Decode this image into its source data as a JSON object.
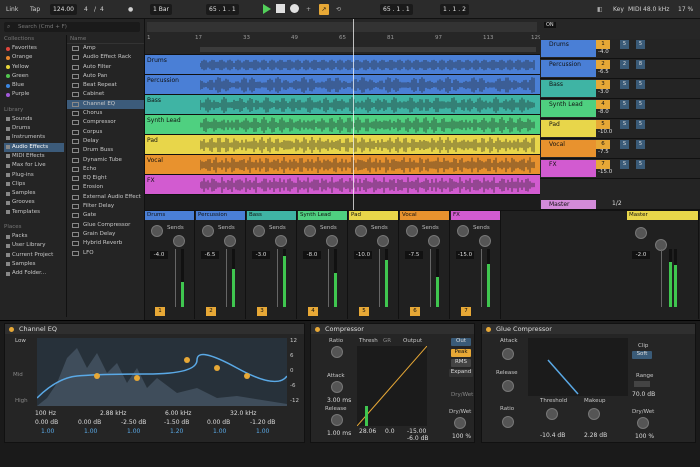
{
  "topbar": {
    "link": "Link",
    "tap": "Tap",
    "tempo": "124.00",
    "meter_num": "4",
    "meter_den": "4",
    "quant": "1 Bar",
    "position": "65 . 1 . 1",
    "position2": "65 . 1 . 1",
    "loop_end": "1 . 1 . 2",
    "key": "Key",
    "midi": "MIDI",
    "sample_rate": "48.0 kHz",
    "cpu": "17 %"
  },
  "browser": {
    "search_placeholder": "Search (Cmd + F)",
    "collections_header": "Collections",
    "collections": [
      {
        "label": "Favorites",
        "color": "#e0463c"
      },
      {
        "label": "Orange",
        "color": "#e8872e"
      },
      {
        "label": "Yellow",
        "color": "#e6d53a"
      },
      {
        "label": "Green",
        "color": "#52c64f"
      },
      {
        "label": "Blue",
        "color": "#3b86e0"
      },
      {
        "label": "Purple",
        "color": "#a259d9"
      }
    ],
    "library_header": "Library",
    "library": [
      "Sounds",
      "Drums",
      "Instruments",
      "Audio Effects",
      "MIDI Effects",
      "Max for Live",
      "Plug-ins",
      "Clips",
      "Samples",
      "Grooves",
      "Templates"
    ],
    "library_selected": "Audio Effects",
    "places_header": "Places",
    "places": [
      "Packs",
      "User Library",
      "Current Project",
      "Samples",
      "Add Folder..."
    ],
    "name_header": "Name",
    "files": [
      "Amp",
      "Audio Effect Rack",
      "Auto Filter",
      "Auto Pan",
      "Beat Repeat",
      "Cabinet",
      "Channel EQ",
      "Chorus",
      "Compressor",
      "Corpus",
      "Delay",
      "Drum Buss",
      "Dynamic Tube",
      "Echo",
      "EQ Eight",
      "Erosion",
      "External Audio Effect",
      "Filter Delay",
      "Gate",
      "Glue Compressor",
      "Grain Delay",
      "Hybrid Reverb",
      "LFO"
    ],
    "files_selected": "Channel EQ"
  },
  "ruler": {
    "ticks": [
      "1",
      "17",
      "33",
      "49",
      "65",
      "81",
      "97",
      "113",
      "129"
    ]
  },
  "tracks": [
    {
      "name": "Drums",
      "color": "#4a7fd6",
      "num": "1",
      "vol": "-4.0",
      "send_a": "5",
      "send_b": "5"
    },
    {
      "name": "Percussion",
      "color": "#4a7fd6",
      "num": "2",
      "vol": "-6.5",
      "send_a": "2",
      "send_b": "8"
    },
    {
      "name": "Bass",
      "color": "#3fb4a4",
      "num": "3",
      "vol": "-3.0",
      "send_a": "S",
      "send_b": "5"
    },
    {
      "name": "Synth Lead",
      "color": "#4fd080",
      "num": "4",
      "vol": "-8.0",
      "send_a": "5",
      "send_b": "5"
    },
    {
      "name": "Pad",
      "color": "#e8d64a",
      "num": "5",
      "vol": "-10.0",
      "send_a": "S",
      "send_b": "5"
    },
    {
      "name": "Vocal",
      "color": "#e8922e",
      "num": "6",
      "vol": "-7.5",
      "send_a": "S",
      "send_b": "5"
    },
    {
      "name": "FX",
      "color": "#d25bd0",
      "num": "7",
      "vol": "-15.0",
      "send_a": "S",
      "send_b": "5"
    }
  ],
  "master": {
    "name": "Master",
    "count": "1/2",
    "vol": "-2.0",
    "header": "Master"
  },
  "mixer": {
    "sends_label": "Sends"
  },
  "channel_eq": {
    "title": "Channel EQ",
    "low": "Low",
    "mid": "Mid",
    "high": "High",
    "params_row1": [
      "100 Hz",
      "2.88 kHz",
      "6.00 kHz",
      "32.0 kHz"
    ],
    "params_row2": [
      "0.00 dB",
      "0.00 dB",
      "-2.50 dB",
      "-1.50 dB",
      "0.00 dB",
      "-1.20 dB"
    ],
    "params_row3": [
      "1.00",
      "1.00",
      "1.00",
      "1.20",
      "1.00",
      "1.00"
    ],
    "scale": [
      "12",
      "6",
      "0",
      "-6",
      "-12"
    ],
    "freq_labels": [
      "100",
      "1k",
      "10k"
    ]
  },
  "compressor": {
    "title": "Compressor",
    "ratio_label": "Ratio",
    "attack_label": "Attack",
    "attack_value": "3.00 ms",
    "release_label": "Release",
    "release_value": "1.00 ms",
    "thresh_label": "Thresh",
    "gr_label": "GR",
    "output_label": "Output",
    "thresh_value": "28.06",
    "gr_value": "0.0",
    "out_value": "-15.00",
    "out2_value": "-6.0 dB",
    "out_btn": "Out",
    "peak_btn": "Peak",
    "rms_btn": "RMS",
    "expand_btn": "Expand",
    "drywet_label": "Dry/Wet",
    "drywet_value": "100 %",
    "drywet2": "Dry/Wet"
  },
  "glue": {
    "title": "Glue Compressor",
    "attack_label": "Attack",
    "release_label": "Release",
    "ratio_label": "Ratio",
    "threshold_label": "Threshold",
    "threshold_value": "-10.4 dB",
    "makeup_label": "Makeup",
    "makeup_value": "2.28 dB",
    "clip_label": "Clip",
    "clip_value": "Soft",
    "range_label": "Range",
    "range_value": "70.0 dB",
    "drywet_label": "Dry/Wet",
    "drywet_value": "100 %"
  }
}
